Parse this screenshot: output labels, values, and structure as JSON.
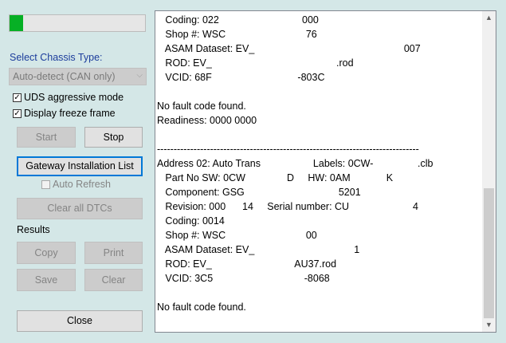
{
  "progress": {
    "fraction": 0.1
  },
  "chassis": {
    "label": "Select Chassis Type:",
    "selected": "Auto-detect (CAN only)"
  },
  "options": {
    "uds_aggressive": {
      "label": "UDS aggressive mode",
      "checked": true
    },
    "freeze_frame": {
      "label": "Display freeze frame",
      "checked": true
    },
    "auto_refresh": {
      "label": "Auto Refresh",
      "checked": false
    }
  },
  "buttons": {
    "start": "Start",
    "stop": "Stop",
    "gateway": "Gateway Installation List",
    "clear_dtcs": "Clear all DTCs",
    "copy": "Copy",
    "print": "Print",
    "save": "Save",
    "clear": "Clear",
    "close": "Close"
  },
  "results_label": "Results",
  "log": {
    "lines": [
      "   Coding: 022                              000",
      "   Shop #: WSC                             76",
      "   ASAM Dataset: EV_                                                      007",
      "   ROD: EV_                                             .rod",
      "   VCID: 68F                               -803C",
      "",
      "No fault code found.",
      "Readiness: 0000 0000",
      "",
      "-------------------------------------------------------------------------------",
      "Address 02: Auto Trans                   Labels: 0CW-                .clb",
      "   Part No SW: 0CW               D     HW: 0AM             K",
      "   Component: GSG                                  5201",
      "   Revision: 000      14     Serial number: CU                       4",
      "   Coding: 0014",
      "   Shop #: WSC                             00",
      "   ASAM Dataset: EV_                                    1",
      "   ROD: EV_                              AU37.rod",
      "   VCID: 3C5                                 -8068",
      "",
      "No fault code found."
    ]
  }
}
